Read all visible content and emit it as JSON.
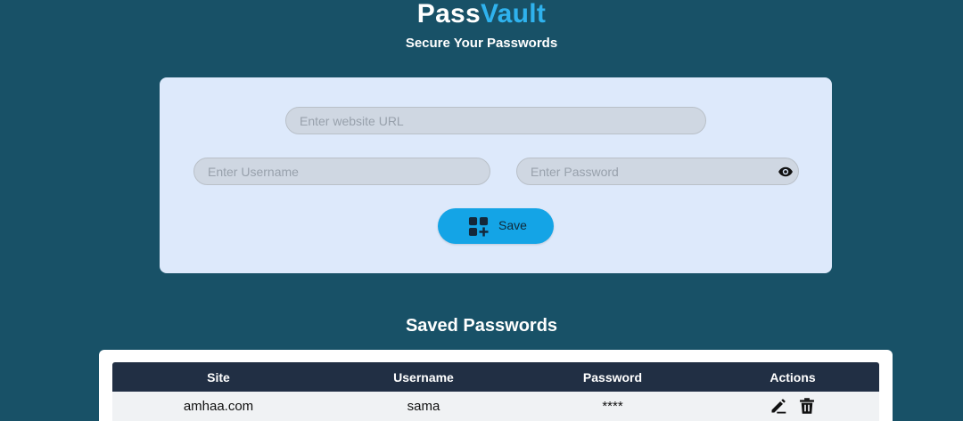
{
  "header": {
    "brand_part1": "Pass",
    "brand_part2": "Vault",
    "tagline": "Secure Your Passwords"
  },
  "form": {
    "url_placeholder": "Enter website URL",
    "username_placeholder": "Enter Username",
    "password_placeholder": "Enter Password",
    "save_label": "Save",
    "eye_icon": "eye-icon",
    "save_icon": "add-grid-icon"
  },
  "saved": {
    "title": "Saved Passwords",
    "columns": [
      "Site",
      "Username",
      "Password",
      "Actions"
    ],
    "rows": [
      {
        "site": "amhaa.com",
        "username": "sama",
        "password": "****"
      }
    ],
    "row_action_icons": [
      "edit-icon",
      "delete-icon"
    ]
  },
  "colors": {
    "background": "#185167",
    "accent": "#2fb2ee",
    "card": "#dde9fb",
    "button": "#14a4e6",
    "table_header": "#212f44"
  }
}
